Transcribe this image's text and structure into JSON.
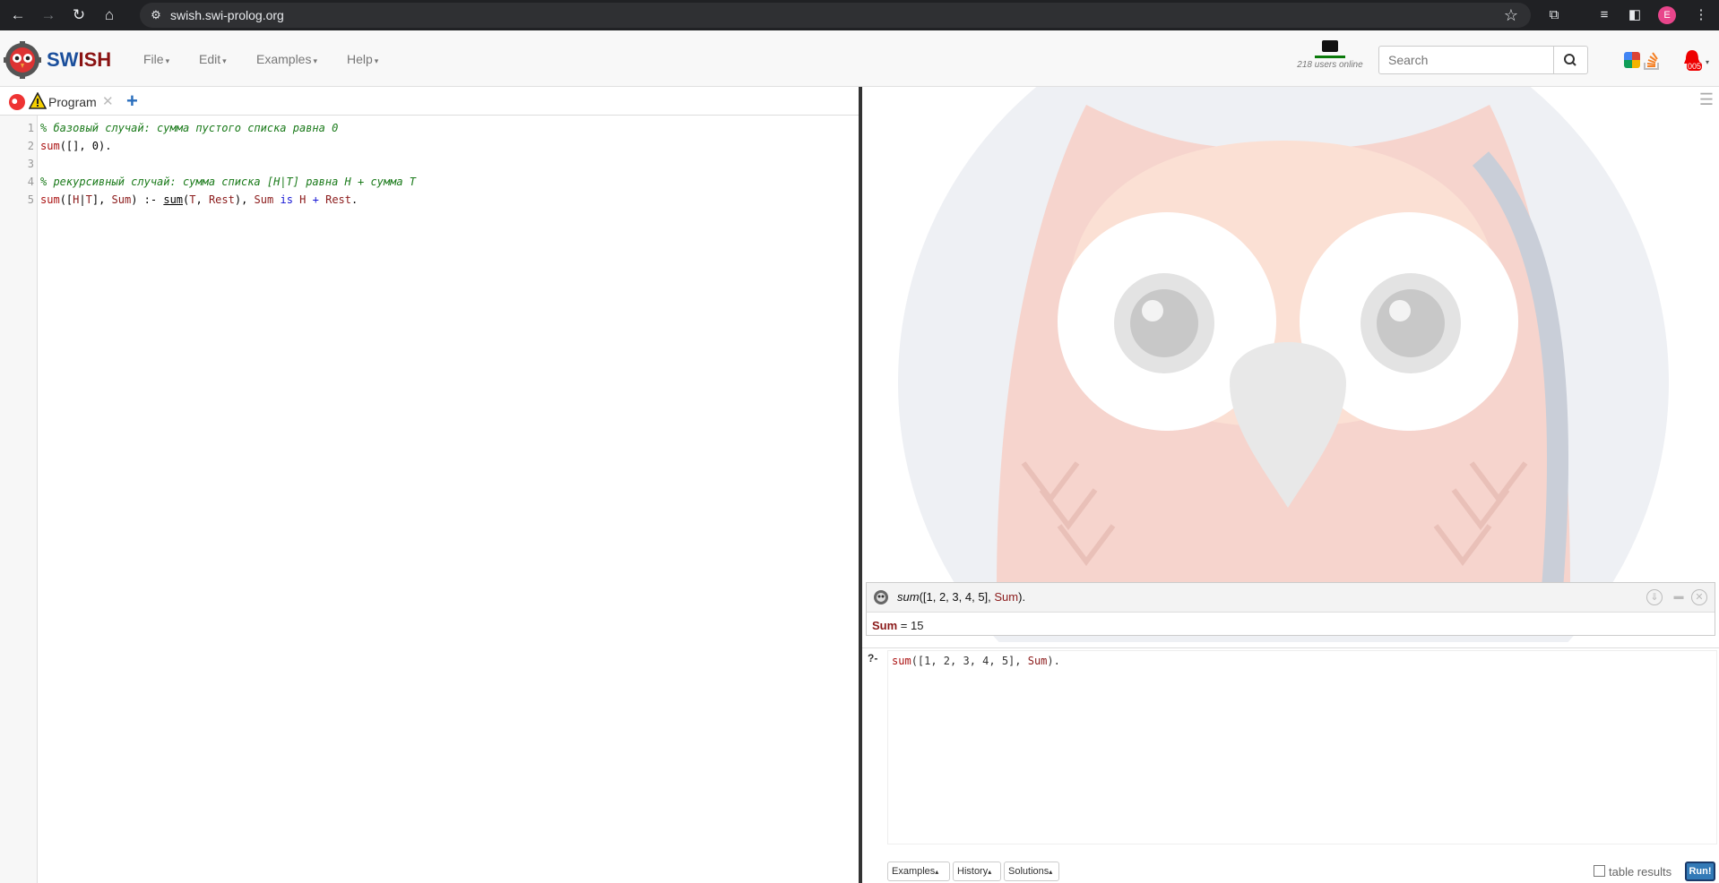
{
  "browser": {
    "url": "swish.swi-prolog.org",
    "profile_initial": "E"
  },
  "header": {
    "brand_sw": "SW",
    "brand_ish": "ISH",
    "menus": [
      {
        "label": "File"
      },
      {
        "label": "Edit"
      },
      {
        "label": "Examples"
      },
      {
        "label": "Help"
      }
    ],
    "users_online": "218 users online",
    "search_placeholder": "Search",
    "notification_count": "005"
  },
  "editor": {
    "tab_label": "Program",
    "lines": [
      "1",
      "2",
      "3",
      "4",
      "5"
    ]
  },
  "answer": {
    "query_fn": "sum",
    "query_args": "([1, 2, 3, 4, 5], ",
    "query_var": "Sum",
    "query_end": ").",
    "result_var": "Sum",
    "result_value": " = 15"
  },
  "query_editor": {
    "prompt": "?-",
    "buttons": {
      "examples": "Examples",
      "history": "History",
      "solutions": "Solutions"
    },
    "table_results_label": "table results",
    "run_label": "Run!"
  },
  "colors": {
    "brand_blue": "#1b4f9c",
    "brand_red": "#8a1212",
    "run_button": "#337ab7",
    "comment_green": "#1a7a1a"
  }
}
